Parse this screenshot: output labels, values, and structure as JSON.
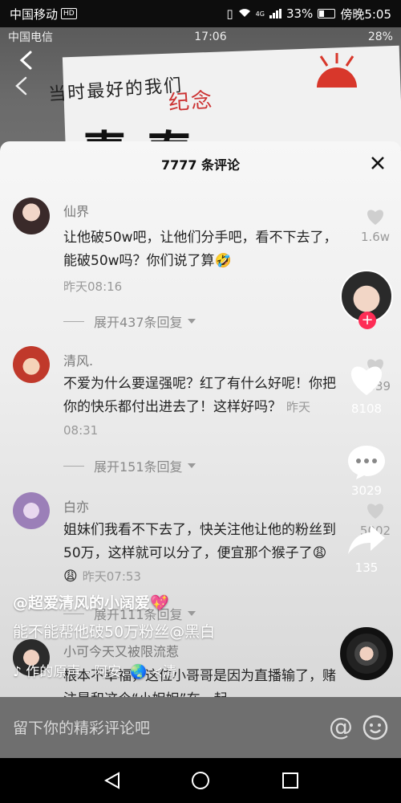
{
  "statusbar": {
    "carrier": "中国移动",
    "hd": "HD",
    "signal": "4G",
    "battery": "33%",
    "time": "傍晚5:05"
  },
  "video": {
    "inner_status": {
      "carrier": "中国电信",
      "time": "17:06",
      "battery": "28%"
    },
    "banner_small": "当时最好的我们",
    "banner_stamp": "纪念",
    "banner_big": "青   春"
  },
  "sheet": {
    "title": "7777 条评论",
    "comments": [
      {
        "name": "仙界",
        "text": "让他破50w吧，让他们分手吧，看不下去了，能破50w吗？你们说了算🤣",
        "time": "昨天08:16",
        "likes": "1.6w",
        "expand": "展开437条回复"
      },
      {
        "name": "清风.",
        "text": "不爱为什么要逞强呢？红了有什么好呢！你把你的快乐都付出进去了！这样好吗？",
        "time": "昨天08:31",
        "likes": "6339",
        "expand": "展开151条回复"
      },
      {
        "name": "白亦",
        "text": "姐妹们我看不下去了，快关注他让他的粉丝到50万，这样就可以分了，便宜那个猴子了😩😩",
        "time": "昨天07:53",
        "likes": "5002",
        "expand": "展开111条回复"
      },
      {
        "name": "小可今天又被限流惹",
        "text": "根本不幸福，这位小哥哥是因为直播输了，赌注是和这个“小妲妲”在一起"
      }
    ]
  },
  "rail": {
    "like_count": "8108",
    "comment_count": "3029",
    "share_count": "135"
  },
  "overlay": {
    "author": "@超爱清风的小阔爱💖",
    "caption": "能不能帮他破50万粉丝@黑白",
    "music": "作的原声 - 阿安. 🌏 ≺清"
  },
  "input": {
    "placeholder": "留下你的精彩评论吧"
  },
  "colors": {
    "accent": "#fe2c55"
  }
}
